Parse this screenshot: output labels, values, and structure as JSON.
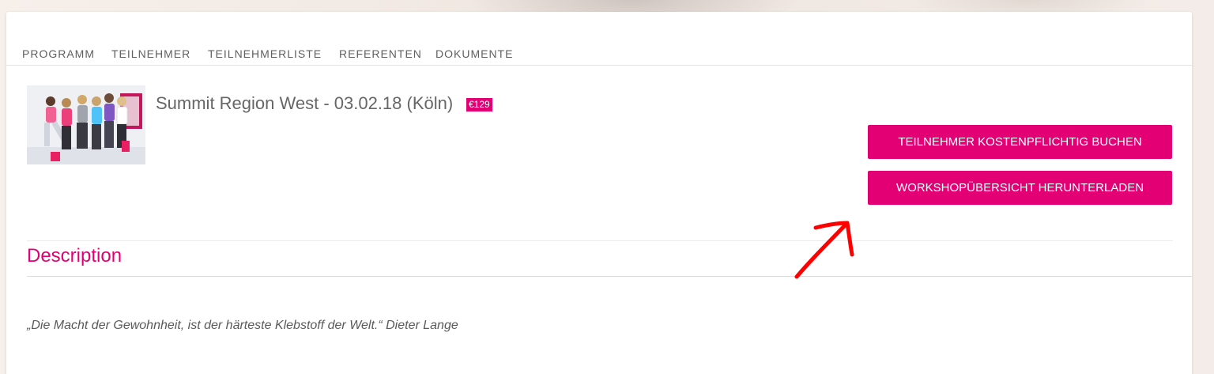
{
  "tabs": [
    "PROGRAMM",
    "TEILNEHMER",
    "TEILNEHMERLISTE",
    "REFERENTEN",
    "DOKUMENTE"
  ],
  "event": {
    "title": "Summit Region West - 03.02.18 (Köln)",
    "price": "€129"
  },
  "buttons": {
    "book": "TEILNEHMER KOSTENPFLICHTIG BUCHEN",
    "download": "WORKSHOPÜBERSICHT HERUNTERLADEN"
  },
  "description": {
    "heading": "Description",
    "quote": "„Die Macht der Gewohnheit, ist der härteste Klebstoff der Welt.“  Dieter Lange"
  },
  "colors": {
    "accent": "#e20074",
    "annotation": "#ff0000"
  },
  "icons": {
    "annotation": "hand-drawn-arrow-icon"
  }
}
